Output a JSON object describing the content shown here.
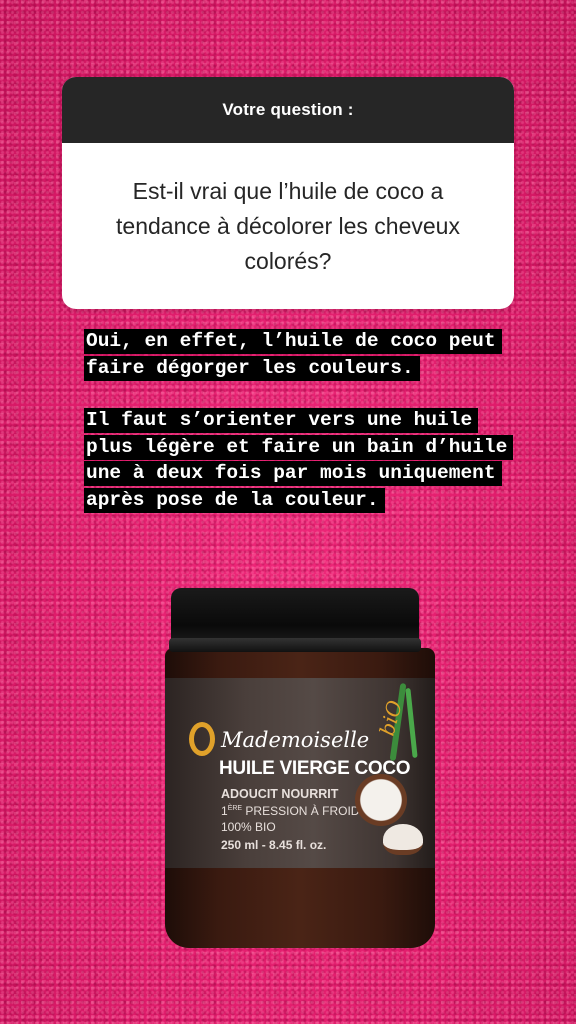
{
  "question_box": {
    "header": "Votre question :",
    "question": "Est-il vrai que l’huile de coco a tendance à décolorer les cheveux colorés?"
  },
  "answer": {
    "paragraph1": "Oui, en effet, l’huile de coco peut faire dégorger les couleurs.",
    "paragraph2": "Il faut s’orienter vers une huile plus légère et faire un bain d’huile une à deux fois par mois uniquement après pose de la couleur."
  },
  "product": {
    "brand": "Mademoiselle",
    "brand_suffix": "biO",
    "name": "HUILE VIERGE COCO",
    "claims": "ADOUCIT NOURRIT",
    "pressing_prefix": "1",
    "pressing_sup": "ÈRE",
    "pressing_rest": " PRESSION À FROID",
    "organic": "100% BIO",
    "volume": "250 ml - 8.45 fl. oz."
  },
  "colors": {
    "background": "#e01c6b",
    "question_header_bg": "#262626",
    "answer_highlight": "#000000",
    "brand_accent": "#e0a12a"
  }
}
